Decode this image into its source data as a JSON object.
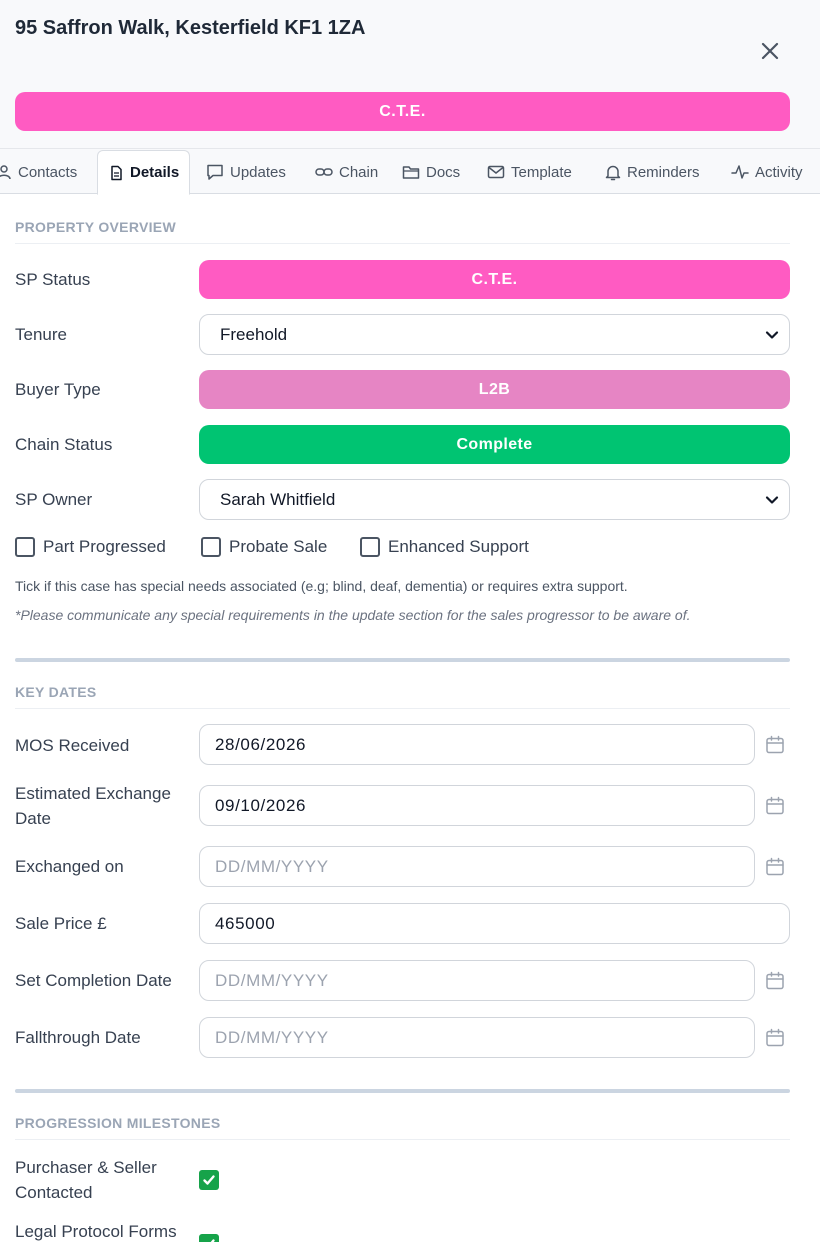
{
  "header": {
    "title": "95 Saffron Walk, Kesterfield KF1 1ZA",
    "status_banner": "C.T.E.",
    "status_color": "#ff5bc2"
  },
  "tabs": [
    {
      "label": "Contacts",
      "icon": "user-icon"
    },
    {
      "label": "Details",
      "icon": "document-icon",
      "active": true
    },
    {
      "label": "Updates",
      "icon": "chat-icon"
    },
    {
      "label": "Chain",
      "icon": "link-icon"
    },
    {
      "label": "Docs",
      "icon": "folder-icon"
    },
    {
      "label": "Template",
      "icon": "mail-icon"
    },
    {
      "label": "Reminders",
      "icon": "bell-icon"
    },
    {
      "label": "Activity",
      "icon": "activity-icon"
    }
  ],
  "overview": {
    "heading": "PROPERTY OVERVIEW",
    "sp_status": {
      "label": "SP Status",
      "value": "C.T.E.",
      "color": "#ff5bc2"
    },
    "tenure": {
      "label": "Tenure",
      "value": "Freehold"
    },
    "buyer_type": {
      "label": "Buyer Type",
      "value": "L2B",
      "color": "#e685c4"
    },
    "chain_status": {
      "label": "Chain Status",
      "value": "Complete",
      "color": "#00c472"
    },
    "sp_owner": {
      "label": "SP Owner",
      "value": "Sarah Whitfield"
    },
    "checkboxes": [
      {
        "label": "Part Progressed",
        "checked": false
      },
      {
        "label": "Probate Sale",
        "checked": false
      },
      {
        "label": "Enhanced Support",
        "checked": false
      }
    ],
    "help_text": "Tick if this case has special needs associated (e.g; blind, deaf, dementia) or requires extra support.",
    "help_note": "*Please communicate any special requirements in the update section for the sales progressor to be aware of."
  },
  "key_dates": {
    "heading": "KEY DATES",
    "mos_received": {
      "label": "MOS Received",
      "value": "28/06/2026"
    },
    "estimated_exchange": {
      "label_line1": "Estimated Exchange",
      "label_line2": "Date",
      "value": "09/10/2026"
    },
    "exchanged_on": {
      "label": "Exchanged on",
      "placeholder": "DD/MM/YYYY"
    },
    "sale_price": {
      "label": "Sale Price £",
      "value": "465000"
    },
    "set_completion": {
      "label": "Set Completion Date",
      "placeholder": "DD/MM/YYYY"
    },
    "fallthrough": {
      "label": "Fallthrough Date",
      "placeholder": "DD/MM/YYYY"
    }
  },
  "milestones": {
    "heading": "PROGRESSION MILESTONES",
    "items": [
      {
        "label_line1": "Purchaser & Seller",
        "label_line2": "Contacted",
        "checked": true
      },
      {
        "label_line1": "Legal Protocol Forms",
        "checked": true
      }
    ]
  }
}
